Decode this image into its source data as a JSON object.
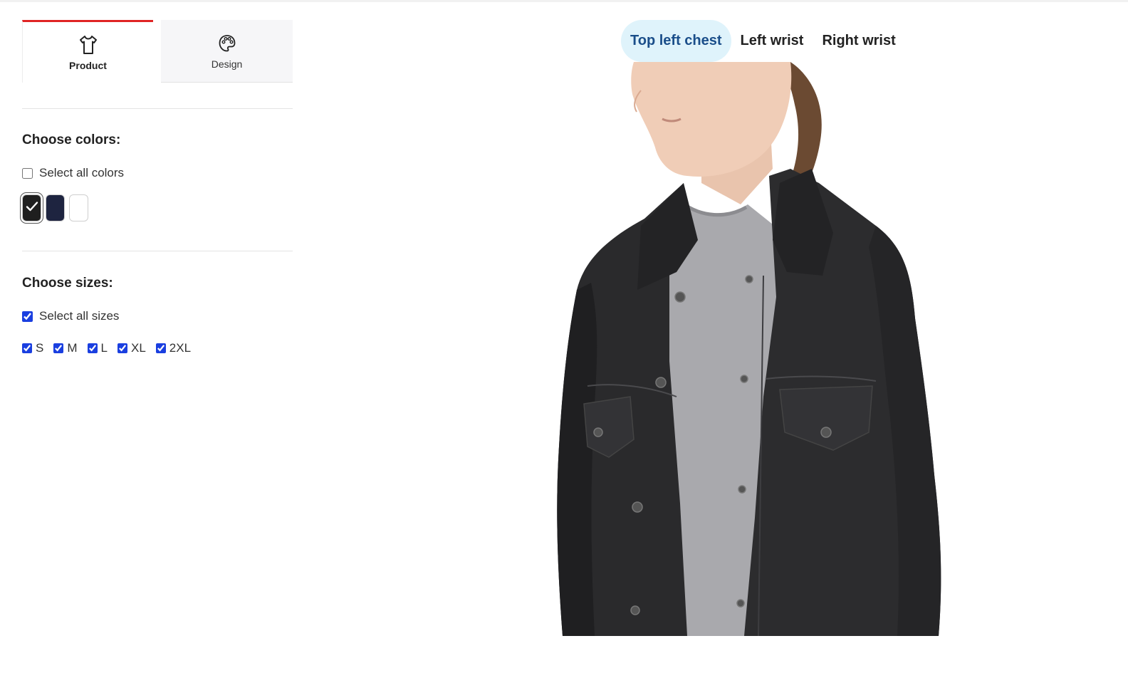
{
  "tabs": [
    {
      "label": "Product",
      "icon": "tshirt-icon",
      "active": true
    },
    {
      "label": "Design",
      "icon": "palette-icon",
      "active": false
    }
  ],
  "colors": {
    "title": "Choose colors:",
    "select_all_label": "Select all colors",
    "select_all_checked": false,
    "swatches": [
      {
        "hex": "#1f1f1f",
        "selected": true
      },
      {
        "hex": "#1e2440",
        "selected": false
      },
      {
        "hex": "#ffffff",
        "selected": false
      }
    ]
  },
  "sizes": {
    "title": "Choose sizes:",
    "select_all_label": "Select all sizes",
    "select_all_checked": true,
    "options": [
      {
        "label": "S",
        "checked": true
      },
      {
        "label": "M",
        "checked": true
      },
      {
        "label": "L",
        "checked": true
      },
      {
        "label": "XL",
        "checked": true
      },
      {
        "label": "2XL",
        "checked": true
      }
    ]
  },
  "placements": [
    {
      "label": "Top left chest",
      "active": true
    },
    {
      "label": "Left wrist",
      "active": false
    },
    {
      "label": "Right wrist",
      "active": false
    }
  ],
  "accent_color": "#e02424"
}
